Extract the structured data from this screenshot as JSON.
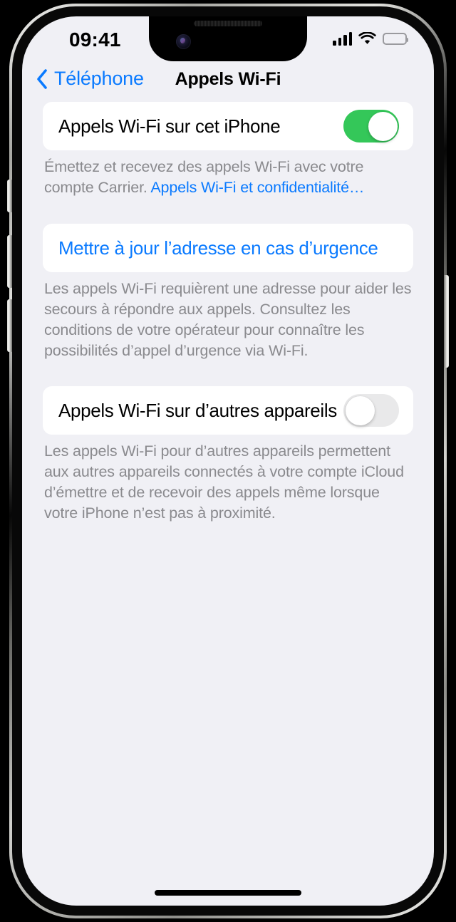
{
  "status_bar": {
    "time": "09:41",
    "cellular_icon": "cellular-signal-icon",
    "wifi_icon": "wifi-icon",
    "battery_icon": "battery-full-icon"
  },
  "nav": {
    "back_icon": "chevron-left-icon",
    "back_label": "Téléphone",
    "title": "Appels Wi-Fi"
  },
  "sections": {
    "this_iphone": {
      "row_label": "Appels Wi-Fi sur cet iPhone",
      "toggle_state": "on",
      "footnote_text": "Émettez et recevez des appels Wi-Fi avec votre compte Carrier. ",
      "footnote_link": "Appels Wi-Fi et confidentialité…"
    },
    "emergency_address": {
      "link_label": "Mettre à jour l’adresse en cas d’urgence",
      "footnote": "Les appels Wi-Fi requièrent une adresse pour aider les secours à répondre aux appels. Consultez les conditions de votre opérateur pour connaître les possibilités d’appel d’urgence via Wi-Fi."
    },
    "other_devices": {
      "row_label": "Appels Wi-Fi sur d’autres appareils",
      "toggle_state": "off",
      "footnote": "Les appels Wi-Fi pour d’autres appareils permettent aux autres appareils connectés à votre compte iCloud d’émettre et de recevoir des appels même lorsque votre iPhone n’est pas à proximité."
    }
  },
  "home_indicator": "home-indicator",
  "colors": {
    "accent_blue": "#0A7AFF",
    "toggle_on_green": "#34C759",
    "toggle_off_gray": "#E9E9EA",
    "background": "#F0F0F5",
    "card": "#FFFFFF",
    "footnote_gray": "#8A8A8E"
  }
}
